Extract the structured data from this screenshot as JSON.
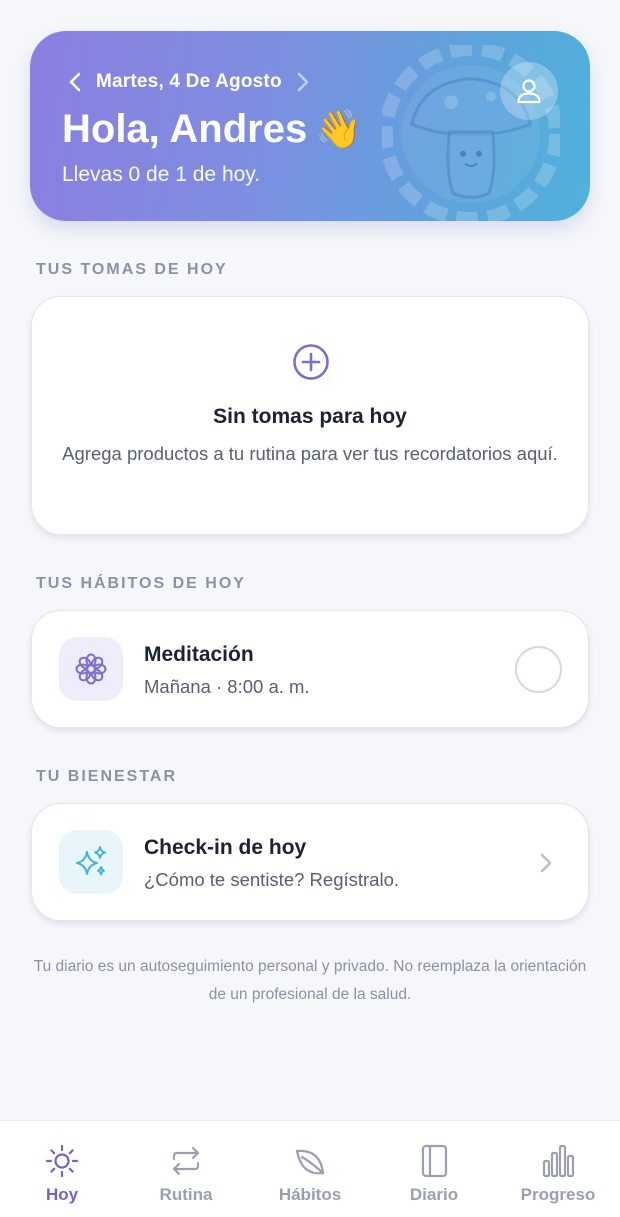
{
  "header": {
    "date": "Martes, 4 De Agosto",
    "greeting": "Hola, Andres",
    "wave_emoji": "👋",
    "progress_text": "Llevas 0 de 1 de hoy.",
    "icons": [
      "chevron-left-icon",
      "chevron-right-icon",
      "user-icon"
    ]
  },
  "doses": {
    "section_title": "TUS TOMAS DE HOY",
    "empty_title": "Sin tomas para hoy",
    "empty_description": "Agrega productos a tu rutina para ver tus recordatorios aquí.",
    "icon": "plus-circle-icon"
  },
  "habits": {
    "section_title": "TUS HÁBITOS DE HOY",
    "items": [
      {
        "name": "Meditación",
        "schedule": "Mañana · 8:00 a. m.",
        "icon": "flower-icon",
        "done": false
      }
    ]
  },
  "wellbeing": {
    "section_title": "TU BIENESTAR",
    "title": "Check-in de hoy",
    "subtitle": "¿Cómo te sentiste? Regístralo.",
    "icon": "sparkles-icon"
  },
  "disclaimer": "Tu diario es un autoseguimiento personal y privado. No reemplaza la orientación de un profesional de la salud.",
  "tabs": [
    {
      "label": "Hoy",
      "icon": "sun-icon",
      "active": true
    },
    {
      "label": "Rutina",
      "icon": "repeat-icon",
      "active": false
    },
    {
      "label": "Hábitos",
      "icon": "leaf-icon",
      "active": false
    },
    {
      "label": "Diario",
      "icon": "journal-icon",
      "active": false
    },
    {
      "label": "Progreso",
      "icon": "bar-chart-icon",
      "active": false
    }
  ],
  "colors": {
    "accent": "#6f63c8",
    "header_gradient_start": "#8a7fe0",
    "header_gradient_end": "#51b1dd",
    "background": "#f6f7fb",
    "muted_text": "#8a92a3"
  }
}
